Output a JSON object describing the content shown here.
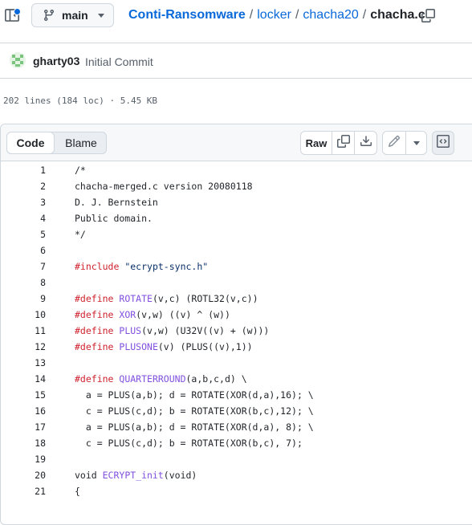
{
  "header": {
    "branch": "main",
    "breadcrumb": {
      "repo": "Conti-Ransomware",
      "folders": [
        "locker",
        "chacha20"
      ],
      "file": "chacha.c",
      "separator": "/"
    }
  },
  "commit": {
    "author": "gharty03",
    "message": "Initial Commit"
  },
  "file_info": {
    "summary": "202 lines (184 loc) · 5.45 KB"
  },
  "file_header": {
    "tabs": [
      "Code",
      "Blame"
    ],
    "active_tab": "Code",
    "raw_label": "Raw"
  },
  "icons": {
    "panel": "panel-toggle-icon",
    "branch": "git-branch-icon",
    "copy_path": "copy-icon",
    "copy_raw": "copy-icon",
    "download": "download-icon",
    "edit": "pencil-icon",
    "more": "triangle-down-icon",
    "symbols": "code-square-icon"
  },
  "colors": {
    "link": "#0969da",
    "keyword": "#cf222e",
    "function": "#8250df",
    "string": "#0a3069"
  },
  "code": {
    "lines": [
      {
        "n": "1",
        "t": [
          {
            "v": "/*"
          }
        ]
      },
      {
        "n": "2",
        "t": [
          {
            "v": "chacha-merged.c version 20080118"
          }
        ]
      },
      {
        "n": "3",
        "t": [
          {
            "v": "D. J. Bernstein"
          }
        ]
      },
      {
        "n": "4",
        "t": [
          {
            "v": "Public domain."
          }
        ]
      },
      {
        "n": "5",
        "t": [
          {
            "v": "*/"
          }
        ]
      },
      {
        "n": "6",
        "t": []
      },
      {
        "n": "7",
        "t": [
          {
            "v": "#include",
            "k": "kw"
          },
          {
            "v": " "
          },
          {
            "v": "\"ecrypt-sync.h\"",
            "k": "str"
          }
        ]
      },
      {
        "n": "8",
        "t": []
      },
      {
        "n": "9",
        "t": [
          {
            "v": "#define",
            "k": "kw"
          },
          {
            "v": " "
          },
          {
            "v": "ROTATE",
            "k": "fn"
          },
          {
            "v": "(v,c) (ROTL32(v,c))"
          }
        ]
      },
      {
        "n": "10",
        "t": [
          {
            "v": "#define",
            "k": "kw"
          },
          {
            "v": " "
          },
          {
            "v": "XOR",
            "k": "fn"
          },
          {
            "v": "(v,w) ((v) ^ (w))"
          }
        ]
      },
      {
        "n": "11",
        "t": [
          {
            "v": "#define",
            "k": "kw"
          },
          {
            "v": " "
          },
          {
            "v": "PLUS",
            "k": "fn"
          },
          {
            "v": "(v,w) (U32V((v) + (w)))"
          }
        ]
      },
      {
        "n": "12",
        "t": [
          {
            "v": "#define",
            "k": "kw"
          },
          {
            "v": " "
          },
          {
            "v": "PLUSONE",
            "k": "fn"
          },
          {
            "v": "(v) (PLUS((v),1))"
          }
        ]
      },
      {
        "n": "13",
        "t": []
      },
      {
        "n": "14",
        "t": [
          {
            "v": "#define",
            "k": "kw"
          },
          {
            "v": " "
          },
          {
            "v": "QUARTERROUND",
            "k": "fn"
          },
          {
            "v": "(a,b,c,d) \\"
          }
        ]
      },
      {
        "n": "15",
        "t": [
          {
            "v": "  a = PLUS(a,b); d = ROTATE(XOR(d,a),16); \\"
          }
        ]
      },
      {
        "n": "16",
        "t": [
          {
            "v": "  c = PLUS(c,d); b = ROTATE(XOR(b,c),12); \\"
          }
        ]
      },
      {
        "n": "17",
        "t": [
          {
            "v": "  a = PLUS(a,b); d = ROTATE(XOR(d,a), 8); \\"
          }
        ]
      },
      {
        "n": "18",
        "t": [
          {
            "v": "  c = PLUS(c,d); b = ROTATE(XOR(b,c), 7);"
          }
        ]
      },
      {
        "n": "19",
        "t": []
      },
      {
        "n": "20",
        "t": [
          {
            "v": "void "
          },
          {
            "v": "ECRYPT_init",
            "k": "fn"
          },
          {
            "v": "(void)"
          }
        ]
      },
      {
        "n": "21",
        "t": [
          {
            "v": "{"
          }
        ]
      }
    ]
  }
}
